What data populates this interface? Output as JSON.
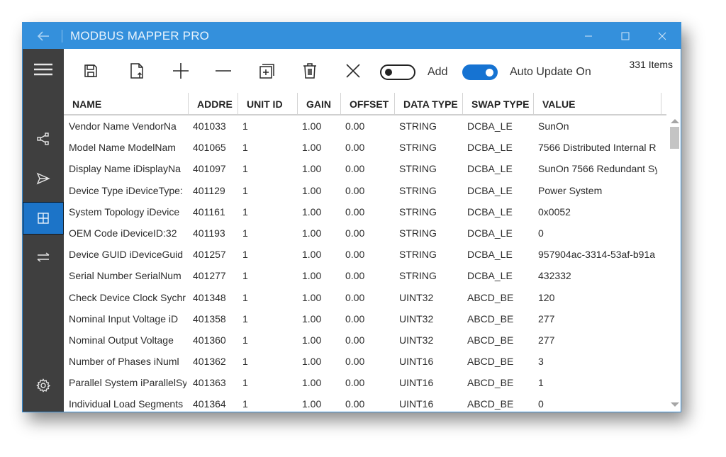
{
  "window": {
    "title": "MODBUS MAPPER PRO",
    "accent_color": "#3490dc"
  },
  "sidebar": {
    "items": [
      {
        "icon": "hamburger-menu-icon",
        "active": false
      },
      {
        "icon": "share-nodes-icon",
        "active": false
      },
      {
        "icon": "send-icon",
        "active": false
      },
      {
        "icon": "grid-icon",
        "active": true
      },
      {
        "icon": "swap-arrows-icon",
        "active": false
      },
      {
        "icon": "gear-icon",
        "active": false
      }
    ]
  },
  "toolbar": {
    "buttons": [
      {
        "name": "save",
        "icon": "save-icon"
      },
      {
        "name": "export",
        "icon": "file-upload-icon"
      },
      {
        "name": "add",
        "icon": "plus-icon"
      },
      {
        "name": "remove",
        "icon": "minus-icon"
      },
      {
        "name": "duplicate",
        "icon": "duplicate-icon"
      },
      {
        "name": "delete",
        "icon": "trash-icon"
      },
      {
        "name": "clear",
        "icon": "close-icon"
      }
    ],
    "add_toggle": {
      "label": "Add",
      "on": false
    },
    "auto_update_toggle": {
      "label": "Auto Update On",
      "on": true
    },
    "item_count": "331 Items"
  },
  "table": {
    "columns": [
      "NAME",
      "ADDRE",
      "UNIT ID",
      "GAIN",
      "OFFSET",
      "DATA TYPE",
      "SWAP TYPE",
      "VALUE"
    ],
    "rows": [
      [
        "Vendor Name  VendorNa",
        "401033",
        "1",
        "1.00",
        "0.00",
        "STRING",
        "DCBA_LE",
        "SunOn"
      ],
      [
        "Model Name  ModelNam",
        "401065",
        "1",
        "1.00",
        "0.00",
        "STRING",
        "DCBA_LE",
        "7566 Distributed Internal R"
      ],
      [
        "Display Name  iDisplayNa",
        "401097",
        "1",
        "1.00",
        "0.00",
        "STRING",
        "DCBA_LE",
        "SunOn 7566 Redundant Sy"
      ],
      [
        "Device Type  iDeviceType:",
        "401129",
        "1",
        "1.00",
        "0.00",
        "STRING",
        "DCBA_LE",
        "Power System"
      ],
      [
        "System Topology  iDevice",
        "401161",
        "1",
        "1.00",
        "0.00",
        "STRING",
        "DCBA_LE",
        "0x0052"
      ],
      [
        "OEM Code  iDeviceID:32",
        "401193",
        "1",
        "1.00",
        "0.00",
        "STRING",
        "DCBA_LE",
        "0"
      ],
      [
        "Device GUID  iDeviceGuid",
        "401257",
        "1",
        "1.00",
        "0.00",
        "STRING",
        "DCBA_LE",
        "957904ac-3314-53af-b91a"
      ],
      [
        "Serial Number  SerialNum",
        "401277",
        "1",
        "1.00",
        "0.00",
        "STRING",
        "DCBA_LE",
        "432332"
      ],
      [
        "Check Device Clock Sychr",
        "401348",
        "1",
        "1.00",
        "0.00",
        "UINT32",
        "ABCD_BE",
        "120"
      ],
      [
        "Nominal Input Voltage  iD",
        "401358",
        "1",
        "1.00",
        "0.00",
        "UINT32",
        "ABCD_BE",
        "277"
      ],
      [
        "Nominal Output Voltage",
        "401360",
        "1",
        "1.00",
        "0.00",
        "UINT32",
        "ABCD_BE",
        "277"
      ],
      [
        "Number of Phases  iNuml",
        "401362",
        "1",
        "1.00",
        "0.00",
        "UINT16",
        "ABCD_BE",
        "3"
      ],
      [
        "Parallel System  iParallelSy",
        "401363",
        "1",
        "1.00",
        "0.00",
        "UINT16",
        "ABCD_BE",
        "1"
      ],
      [
        "Individual Load Segments",
        "401364",
        "1",
        "1.00",
        "0.00",
        "UINT16",
        "ABCD_BE",
        "0"
      ]
    ]
  }
}
